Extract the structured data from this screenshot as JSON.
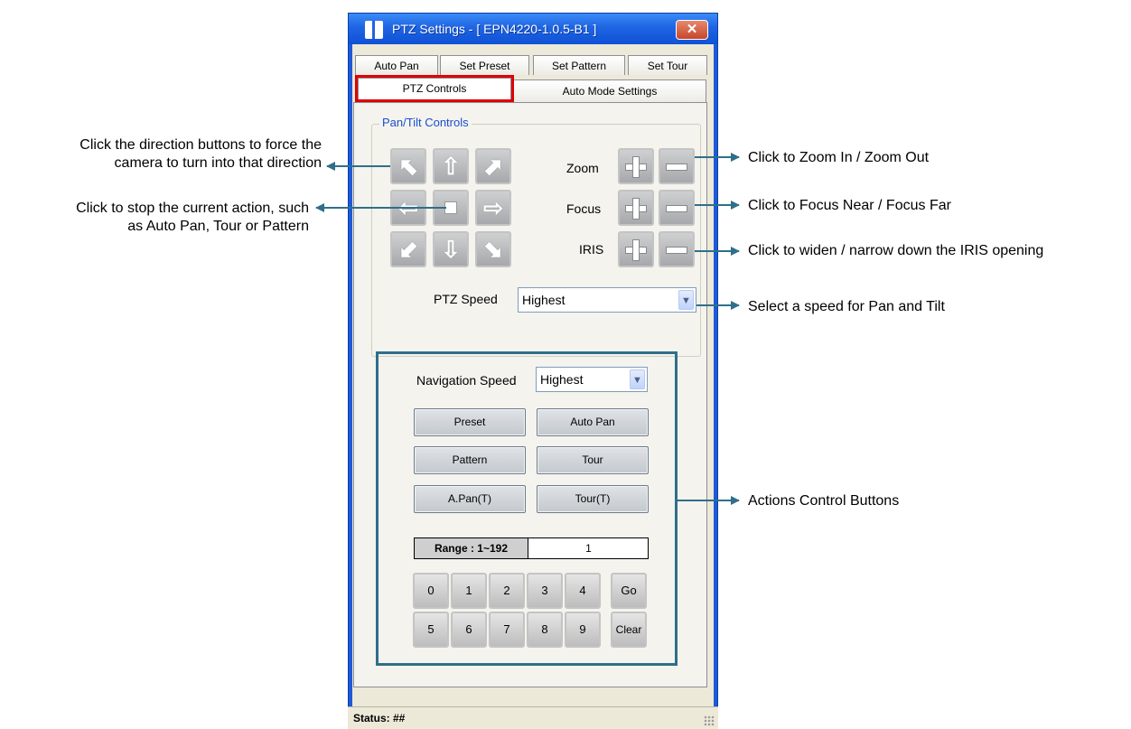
{
  "window": {
    "title": "PTZ Settings - [ EPN4220-1.0.5-B1 ]",
    "close_label": "✕"
  },
  "tabs": {
    "row1": [
      "Auto Pan",
      "Set Preset",
      "Set Pattern",
      "Set Tour"
    ],
    "row2": [
      "PTZ Controls",
      "Auto Mode Settings"
    ],
    "active": "PTZ Controls"
  },
  "pan_tilt": {
    "group_label": "Pan/Tilt Controls",
    "directions": [
      "up-left",
      "up",
      "up-right",
      "left",
      "stop",
      "right",
      "down-left",
      "down",
      "down-right"
    ],
    "zoom_label": "Zoom",
    "focus_label": "Focus",
    "iris_label": "IRIS",
    "speed_label": "PTZ Speed",
    "speed_value": "Highest"
  },
  "actions": {
    "nav_speed_label": "Navigation Speed",
    "nav_speed_value": "Highest",
    "buttons": [
      "Preset",
      "Auto Pan",
      "Pattern",
      "Tour",
      "A.Pan(T)",
      "Tour(T)"
    ],
    "range_label": "Range : 1~192",
    "range_value": "1",
    "keypad_row1": [
      "0",
      "1",
      "2",
      "3",
      "4"
    ],
    "keypad_row2": [
      "5",
      "6",
      "7",
      "8",
      "9"
    ],
    "go_label": "Go",
    "clear_label": "Clear"
  },
  "status": {
    "text": "Status:  ##"
  },
  "annotations": {
    "direction_line1": "Click the direction buttons to force the",
    "direction_line2": "camera to turn into that direction",
    "stop_line1": "Click to stop the current action, such",
    "stop_line2": "as Auto Pan, Tour or Pattern",
    "zoom": "Click to Zoom In / Zoom Out",
    "focus": "Click to Focus Near / Focus Far",
    "iris": "Click to widen / narrow down the IRIS opening",
    "speed": "Select a speed for Pan and Tilt",
    "actions": "Actions Control Buttons"
  },
  "colors": {
    "annotation_arrow": "#2f6f8a",
    "highlight_red": "#e00000",
    "title_blue": "#1f64e3"
  }
}
